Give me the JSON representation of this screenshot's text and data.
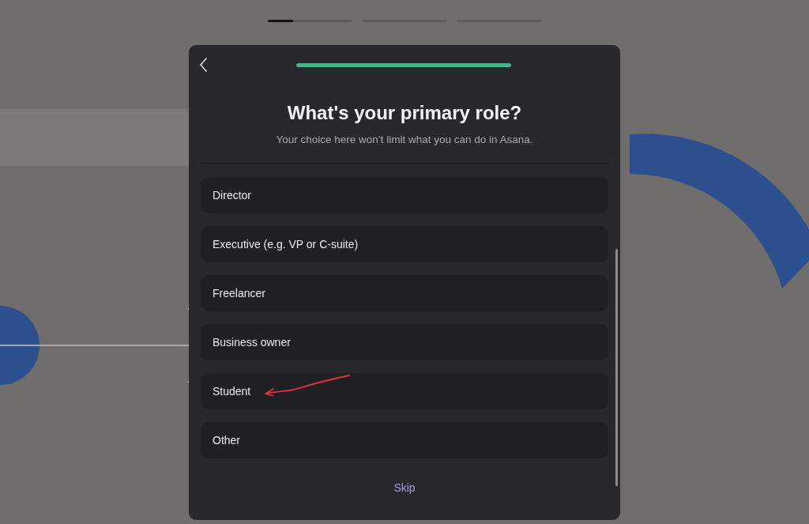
{
  "steps": [
    {
      "level": 0.3
    },
    {
      "level": 0
    },
    {
      "level": 0
    }
  ],
  "dialog": {
    "progress": {
      "level": 1
    },
    "title": "What's your primary role?",
    "subtitle": "Your choice here won’t limit what you can do in Asana.",
    "options": [
      {
        "label": "Director",
        "annotated": false
      },
      {
        "label": "Executive (e.g. VP or C-suite)",
        "annotated": false
      },
      {
        "label": "Freelancer",
        "annotated": false
      },
      {
        "label": "Business owner",
        "annotated": false
      },
      {
        "label": "Student",
        "annotated": true
      },
      {
        "label": "Other",
        "annotated": false
      }
    ],
    "skip": "Skip"
  }
}
